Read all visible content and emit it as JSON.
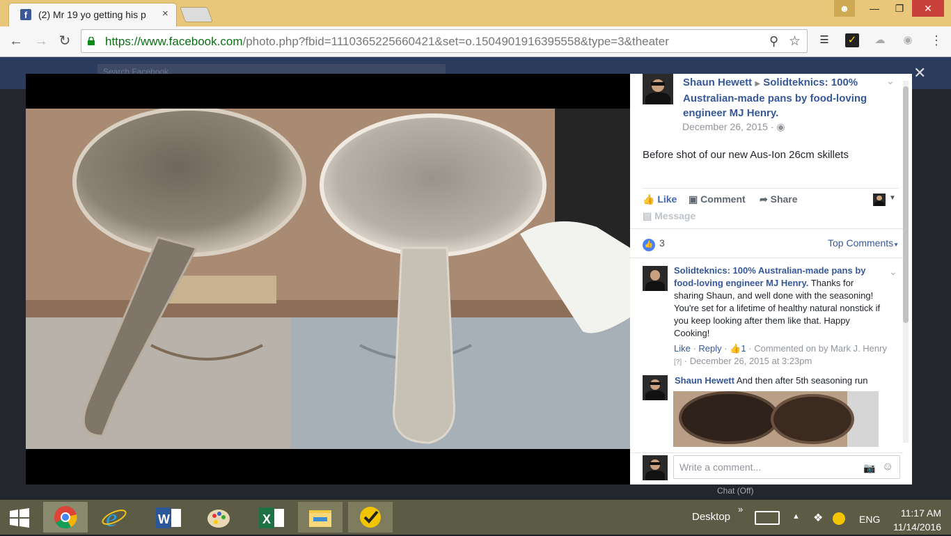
{
  "browser": {
    "tab_title": "(2) Mr 19 yo getting his p",
    "tab_close": "×",
    "url_host": "https://www.facebook.com",
    "url_path": "/photo.php?fbid=1110365225660421&set=o.1504901916395558&type=3&theater",
    "window_controls": {
      "minimize": "—",
      "maximize": "❐",
      "close": "✕"
    }
  },
  "facebook": {
    "search_placeholder": "Search Facebook",
    "theater_close": "✕",
    "post": {
      "author": "Shaun Hewett",
      "page": "Solidteknics: 100% Australian-made pans by food-loving engineer MJ Henry.",
      "date": "December 26, 2015",
      "text": "Before shot of our new Aus-Ion 26cm skillets"
    },
    "actions": {
      "like": "Like",
      "comment": "Comment",
      "share": "Share",
      "message": "Message"
    },
    "reactions_count": "3",
    "top_comments": "Top Comments",
    "comments": [
      {
        "author": "Solidteknics: 100% Australian-made pans by food-loving engineer MJ Henry.",
        "text": "Thanks for sharing Shaun, and well done with the seasoning! You're set for a lifetime of healthy natural nonstick if you keep looking after them like that. Happy Cooking!",
        "like": "Like",
        "reply": "Reply",
        "likes": "1",
        "commented_on_by": "Commented on by Mark J. Henry",
        "help_mark": "[?]",
        "timestamp": "December 26, 2015 at 3:23pm"
      },
      {
        "author": "Shaun Hewett",
        "text": "And then after 5th seasoning run"
      }
    ],
    "write_comment_placeholder": "Write a comment...",
    "chat_status": "Chat (Off)"
  },
  "taskbar": {
    "desktop_label": "Desktop",
    "language": "ENG",
    "time": "11:17 AM",
    "date": "11/14/2016"
  },
  "colors": {
    "chrome_frame": "#e9c77a",
    "facebook_blue": "#365899",
    "taskbar": "#5b5b46"
  }
}
